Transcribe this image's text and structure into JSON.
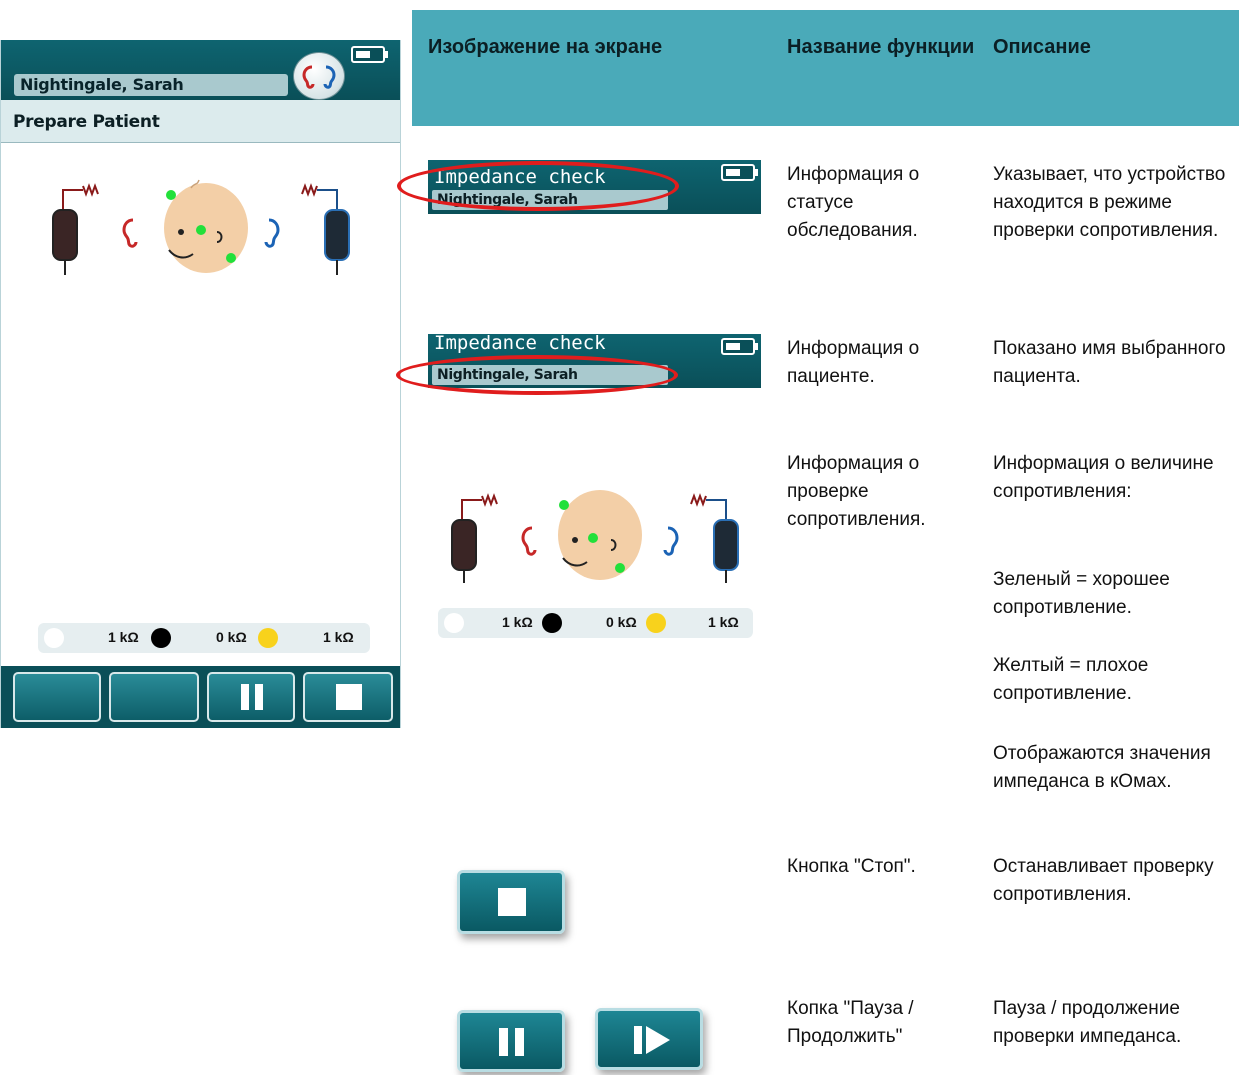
{
  "device": {
    "patient_name": "Nightingale, Sarah",
    "subtitle": "Prepare Patient",
    "readout": {
      "white": "1 kΩ",
      "black": "0 kΩ",
      "yellow": "1 kΩ"
    },
    "battery_icon": "battery-icon",
    "logo_icon": "ear-logo-icon",
    "buttons": [
      "blank",
      "blank",
      "pause",
      "stop"
    ]
  },
  "table": {
    "headers": [
      "Изображение на экране",
      "Название функции",
      "Описание"
    ],
    "rows": [
      {
        "name": "Информация о статусе обследования.",
        "desc": "Указывает, что устройство находится в режиме проверки сопротивления."
      },
      {
        "name": "Информация о пациенте.",
        "desc": "Показано имя выбранного пациента."
      },
      {
        "name": "Информация о проверке сопротивления.",
        "desc": [
          "Информация о величине сопротивления:",
          "Зеленый = хорошее сопротивление.",
          "Желтый = плохое сопротивление.",
          "Отображаются значения импеданса в кОмах."
        ]
      },
      {
        "name": "Кнопка \"Стоп\".",
        "desc": "Останавливает проверку сопротивления."
      },
      {
        "name": "Копка \"Пауза / Продолжить\"",
        "desc": "Пауза / продолжение проверки импеданса."
      }
    ]
  },
  "status_bar": {
    "title": "Impedance check",
    "patient_name": "Nightingale, Sarah"
  },
  "mini_readout": {
    "white": "1 kΩ",
    "black": "0 kΩ",
    "yellow": "1 kΩ"
  },
  "colors": {
    "header_teal": "#0a4f58",
    "table_header": "#4aaab9",
    "highlight_ring": "#e01d1d",
    "good": "#22e03a",
    "poor": "#f8d21c"
  }
}
